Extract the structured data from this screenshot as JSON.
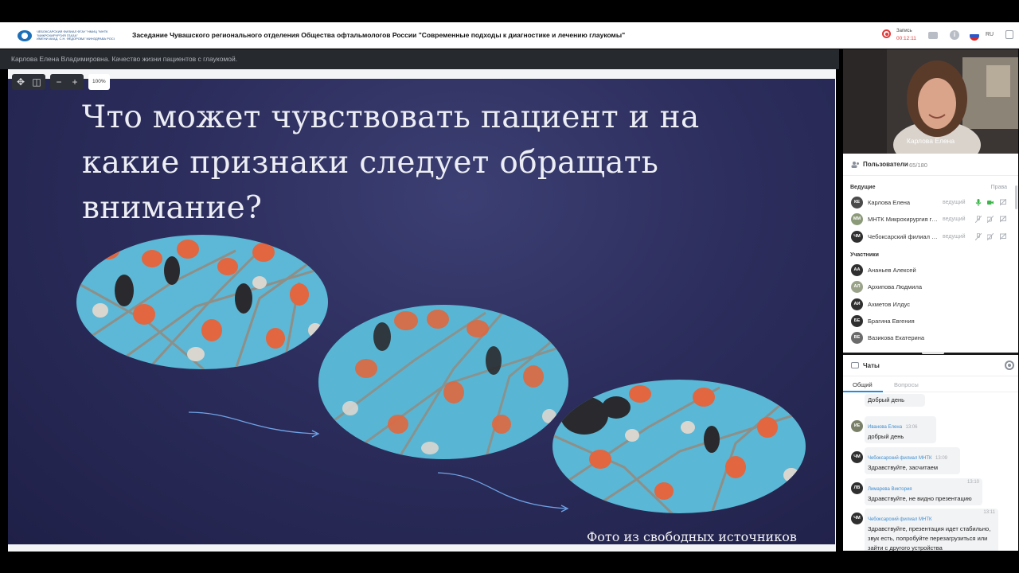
{
  "header": {
    "logo_lines": [
      "ЧЕБОКСАРСКИЙ ФИЛИАЛ ФГАУ \"НМИЦ \"МНТК",
      "\"МИКРОХИРУРГИЯ ГЛАЗА\"",
      "ИМЕНИ АКАД. С.Н. ФЁДОРОВА\" МИНЗДРАВА РОССИИ"
    ],
    "title": "Заседание Чувашского регионального отделения Общества офтальмологов России \"Современные подходы к диагностике и лечению глаукомы\"",
    "record_label": "Запись",
    "record_time": "00:12:11",
    "language": "RU"
  },
  "presentation": {
    "name": "Карлова Елена Владимировна. Качество жизни пациентов с глаукомой.",
    "zoom": "100%",
    "zoom_minus": "−",
    "zoom_plus": "+",
    "slide": {
      "title": "Что может чувствовать пациент и на какие признаки следует обращать внимание?",
      "caption": "Фото из свободных источников"
    }
  },
  "video": {
    "name": "Карлова Елена"
  },
  "users": {
    "title": "Пользователи",
    "count": "65/180",
    "hosts_label": "Ведущие",
    "rights_label": "Права",
    "hosts": [
      {
        "initials": "КЕ",
        "name": "Карлова Елена",
        "role": "ведущий",
        "color": "#4a4a4a"
      },
      {
        "initials": "ММ",
        "name": "МНТК Микрохирургия глаза",
        "role": "ведущий",
        "color": "#8c9a7a"
      },
      {
        "initials": "ЧМ",
        "name": "Чебоксарский филиал МНТК",
        "role": "ведущий",
        "color": "#2f2f2f"
      }
    ],
    "participants_label": "Участники",
    "participants": [
      {
        "initials": "АА",
        "name": "Ананьев Алексей",
        "color": "#2f2f2f"
      },
      {
        "initials": "АЛ",
        "name": "Архипова Людмила",
        "color": "#9aa38a"
      },
      {
        "initials": "АИ",
        "name": "Ахметов Илдус",
        "color": "#2f2f2f"
      },
      {
        "initials": "БЕ",
        "name": "Брагина Евгения",
        "color": "#2f2f2f"
      },
      {
        "initials": "ВЕ",
        "name": "Вазикова Екатерина",
        "color": "#6b6b6b"
      }
    ]
  },
  "chat": {
    "title": "Чаты",
    "tabs": [
      "Общий",
      "Вопросы"
    ],
    "messages": [
      {
        "initials": "",
        "author": "",
        "time": "",
        "text": "Добрый день",
        "color": "#666"
      },
      {
        "initials": "ИЕ",
        "author": "Иванова Елена",
        "time": "13:06",
        "text": "добрый день",
        "color": "#7a8068"
      },
      {
        "initials": "ЧМ",
        "author": "Чебоксарский филиал МНТК",
        "time": "13:09",
        "text": "Здравствуйте, засчитаем",
        "color": "#2f2f2f"
      },
      {
        "initials": "ЛВ",
        "author": "Лимарева Виктория",
        "time": "13:10",
        "text": "Здравствуйте, не видно презентацию",
        "color": "#2f2f2f"
      },
      {
        "initials": "ЧМ",
        "author": "Чебоксарский филиал МНТК",
        "time": "13:11",
        "text": "Здравствуйте, презентация идет стабильно, звук есть, попробуйте перезагрузиться или зайти с другого устройства",
        "color": "#2f2f2f"
      }
    ]
  },
  "colors": {
    "accent": "#1f8ce6",
    "record": "#e23a3a",
    "mic_on": "#3cb54a",
    "slide_bg": "#2c2d5c"
  }
}
